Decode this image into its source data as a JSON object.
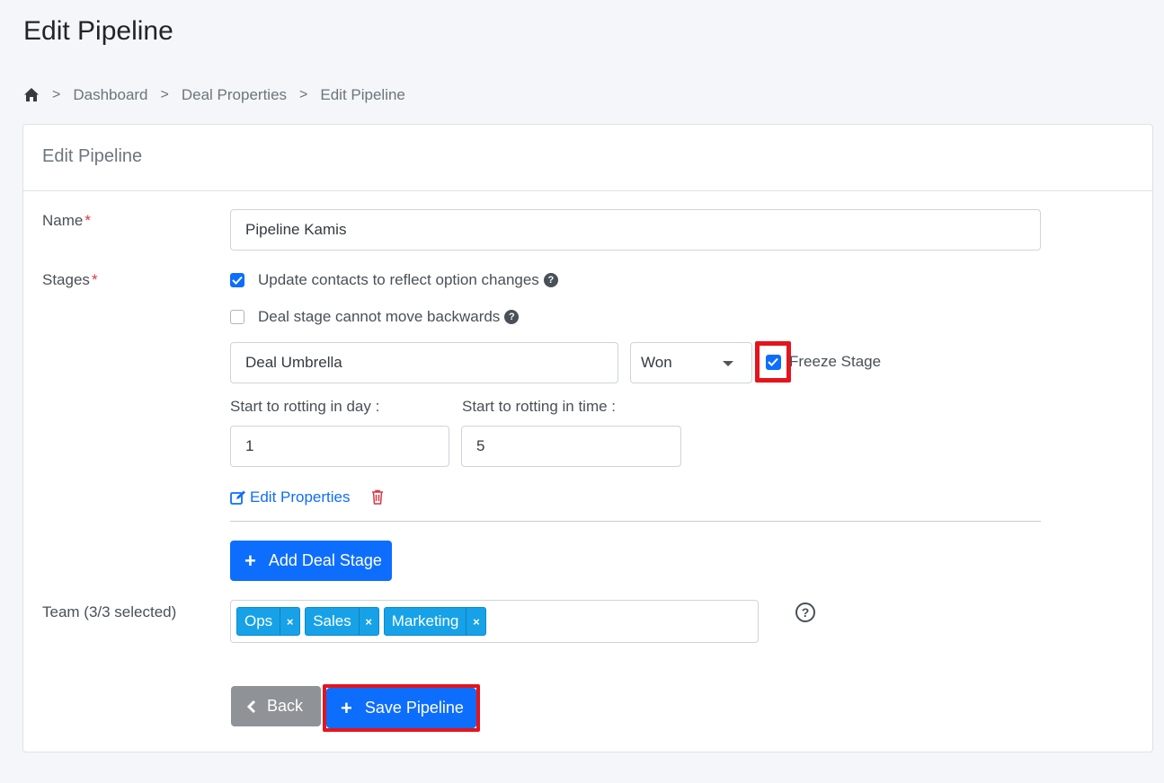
{
  "page": {
    "title": "Edit Pipeline"
  },
  "breadcrumb": {
    "items": [
      "Dashboard",
      "Deal Properties",
      "Edit Pipeline"
    ],
    "separator": ">"
  },
  "card": {
    "header": "Edit Pipeline"
  },
  "form": {
    "name_label": "Name",
    "required_mark": "*",
    "name_value": "Pipeline Kamis",
    "stages_label": "Stages",
    "update_contacts": {
      "label": "Update contacts to reflect option changes",
      "checked": true
    },
    "no_backwards": {
      "label": "Deal stage cannot move backwards",
      "checked": false
    },
    "stage": {
      "name": "Deal Umbrella",
      "status": "Won",
      "freeze_label": "Freeze Stage",
      "freeze_checked": true,
      "rot_day_label": "Start to rotting in day :",
      "rot_day_value": "1",
      "rot_time_label": "Start to rotting in time :",
      "rot_time_value": "5",
      "edit_properties": "Edit Properties"
    },
    "add_stage_label": "Add Deal Stage",
    "team_label": "Team (3/3 selected)",
    "team_tags": [
      "Ops",
      "Sales",
      "Marketing"
    ],
    "tag_remove": "×",
    "help_glyph": "?",
    "back_label": "Back",
    "save_label": "Save Pipeline"
  },
  "colors": {
    "primary": "#0d6efd",
    "danger": "#dc3545",
    "highlight": "#e5141c",
    "tag": "#17a2e8"
  }
}
